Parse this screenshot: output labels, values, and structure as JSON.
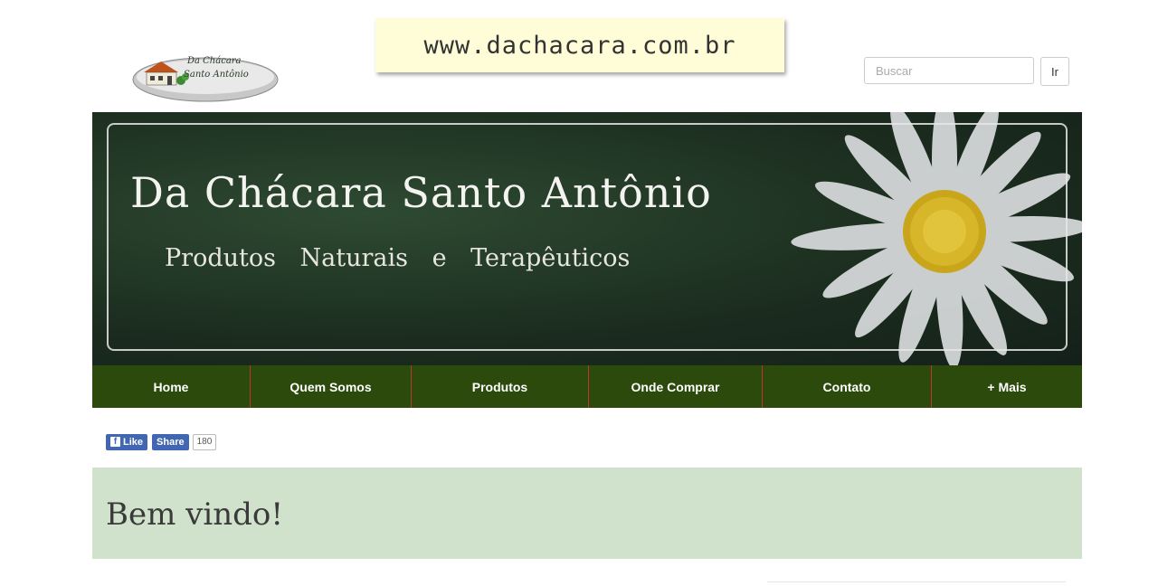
{
  "url_banner": {
    "text": "www.dachacara.com.br"
  },
  "logo": {
    "line1": "Da  Chácara",
    "line2": "Santo   Antônio"
  },
  "search": {
    "placeholder": "Buscar",
    "button_label": "Ir"
  },
  "hero": {
    "title": "Da Chácara Santo Antônio",
    "subtitle": "Produtos Naturais e Terapêuticos"
  },
  "nav": {
    "items": [
      {
        "label": "Home"
      },
      {
        "label": "Quem Somos"
      },
      {
        "label": "Produtos"
      },
      {
        "label": "Onde Comprar"
      },
      {
        "label": "Contato"
      },
      {
        "label": "+ Mais"
      }
    ]
  },
  "social": {
    "like_label": "Like",
    "share_label": "Share",
    "count": "180"
  },
  "welcome": {
    "title": "Bem vindo!"
  },
  "colors": {
    "nav_bg": "#2c4a0b",
    "nav_divider": "#b53a2a",
    "welcome_bg": "#d0e2cb",
    "banner_bg": "#fefdd8",
    "facebook_blue": "#4267b2"
  }
}
